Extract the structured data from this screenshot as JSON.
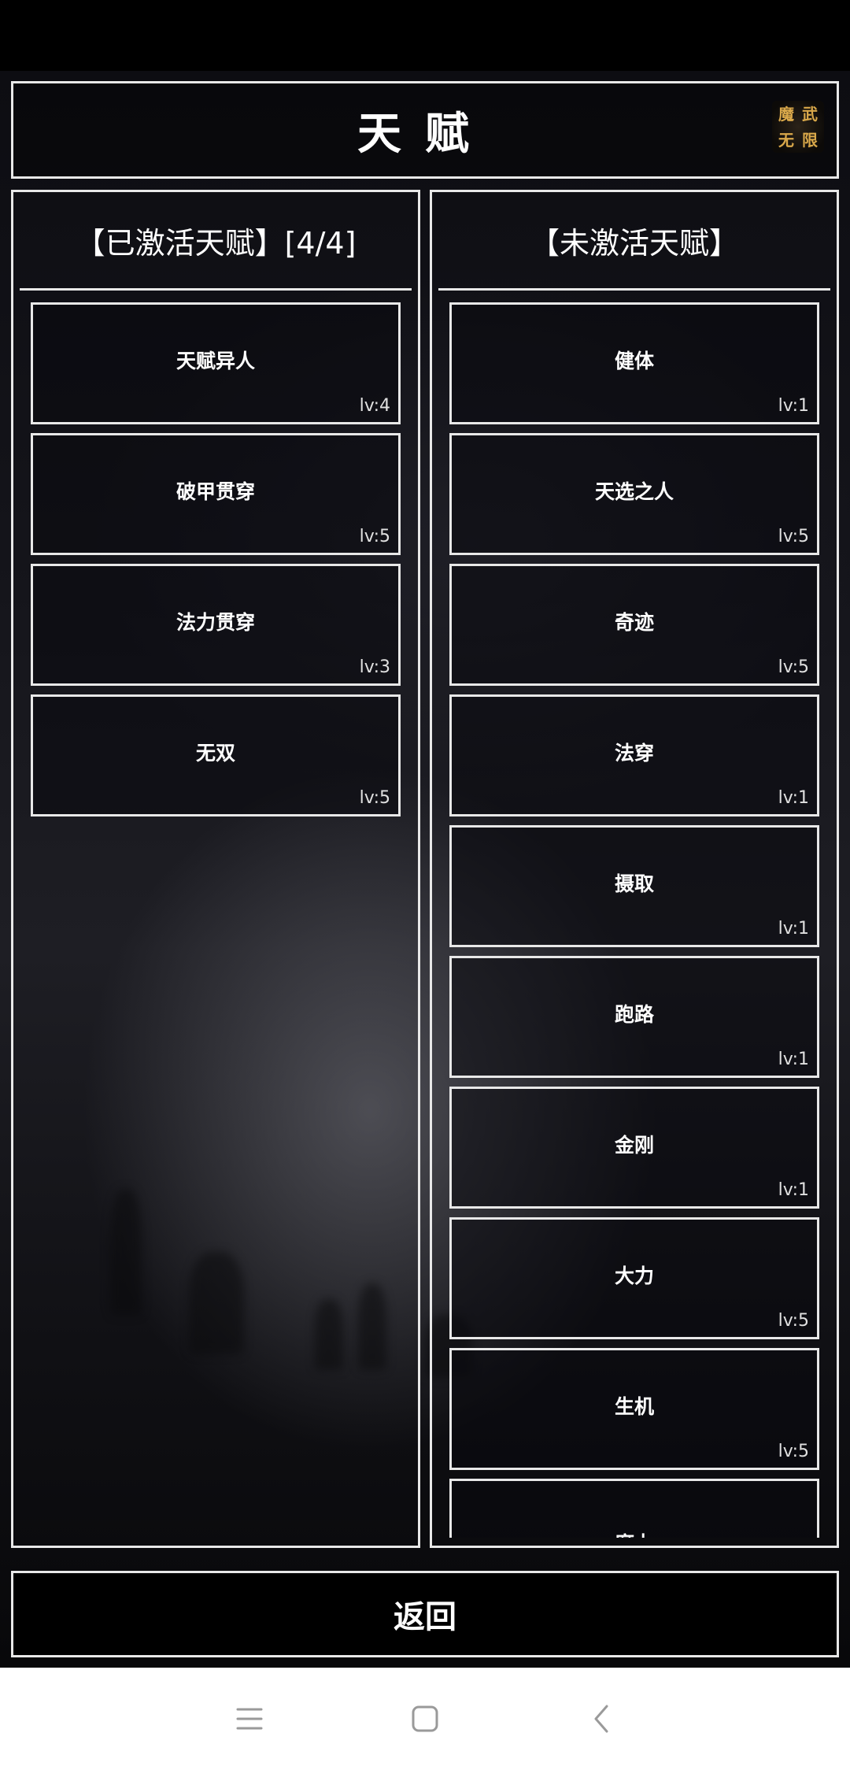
{
  "title": "天赋",
  "logo_text": [
    "魔",
    "武",
    "无",
    "限"
  ],
  "active_panel": {
    "header": "【已激活天赋】[4/4]",
    "items": [
      {
        "name": "天赋异人",
        "level": "lv:4"
      },
      {
        "name": "破甲贯穿",
        "level": "lv:5"
      },
      {
        "name": "法力贯穿",
        "level": "lv:3"
      },
      {
        "name": "无双",
        "level": "lv:5"
      }
    ]
  },
  "inactive_panel": {
    "header": "【未激活天赋】",
    "items": [
      {
        "name": "健体",
        "level": "lv:1"
      },
      {
        "name": "天选之人",
        "level": "lv:5"
      },
      {
        "name": "奇迹",
        "level": "lv:5"
      },
      {
        "name": "法穿",
        "level": "lv:1"
      },
      {
        "name": "摄取",
        "level": "lv:1"
      },
      {
        "name": "跑路",
        "level": "lv:1"
      },
      {
        "name": "金刚",
        "level": "lv:1"
      },
      {
        "name": "大力",
        "level": "lv:5"
      },
      {
        "name": "生机",
        "level": "lv:5"
      },
      {
        "name": "魔力",
        "level": ""
      }
    ]
  },
  "back_button": {
    "label": "返回"
  },
  "nav_bar": {
    "icons": [
      "menu-icon",
      "home-square-icon",
      "back-chevron-icon"
    ]
  },
  "colors": {
    "border": "#e8e8e8",
    "text": "#ffffff",
    "logo": "#d9a84a"
  }
}
